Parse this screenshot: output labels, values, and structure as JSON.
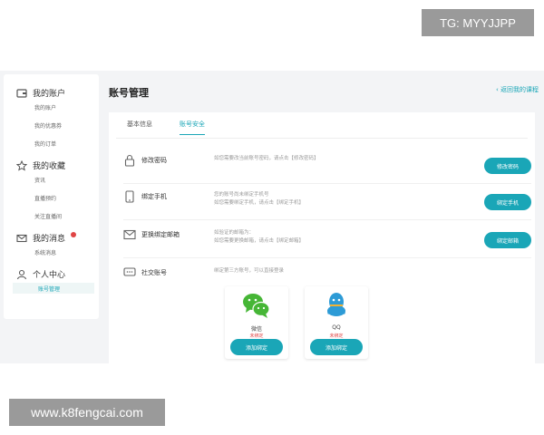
{
  "overlay": {
    "tg_label": "TG: MYYJJPP",
    "site_watermark": "www.k8fengcai.com"
  },
  "sidebar": {
    "groups": [
      {
        "title": "我的账户",
        "icon": "wallet-icon",
        "items": [
          "我的账户",
          "我的优惠券",
          "我的订单"
        ]
      },
      {
        "title": "我的收藏",
        "icon": "star-icon",
        "items": [
          "资讯",
          "直播预约",
          "关注直播间"
        ]
      },
      {
        "title": "我的消息",
        "icon": "mail-icon",
        "items": [
          "系统消息"
        ]
      },
      {
        "title": "个人中心",
        "icon": "user-icon",
        "items": [
          "账号管理"
        ]
      }
    ]
  },
  "main": {
    "title": "账号管理",
    "back_link": "返回我的课程",
    "tabs": [
      {
        "label": "基本信息",
        "active": false
      },
      {
        "label": "账号安全",
        "active": true
      }
    ],
    "rows": [
      {
        "icon": "lock-icon",
        "label": "修改密码",
        "desc1": "如您需要改当前账号密码，请点击【修改密码】",
        "desc2": "",
        "button": "修改密码"
      },
      {
        "icon": "phone-icon",
        "label": "绑定手机",
        "desc1": "您的账号尚未绑定手机号",
        "desc2": "如您需要绑定手机，请点击【绑定手机】",
        "button": "绑定手机"
      },
      {
        "icon": "mail-icon",
        "label": "更换绑定邮箱",
        "desc1": "如验证的邮箱为：",
        "desc2": "如您需要更换邮箱，请点击【绑定邮箱】",
        "button": "绑定邮箱"
      },
      {
        "icon": "chat-icon",
        "label": "社交账号",
        "desc1": "绑定第三方账号，可以直接登录",
        "desc2": "",
        "button": ""
      }
    ],
    "social": [
      {
        "name": "微信",
        "status": "未绑定",
        "button": "添加绑定",
        "icon": "wechat-icon"
      },
      {
        "name": "QQ",
        "status": "未绑定",
        "button": "添加绑定",
        "icon": "qq-icon"
      }
    ]
  },
  "colors": {
    "accent": "#1aa6b7",
    "wechat": "#46b636",
    "qq": "#2d9bd6",
    "alert": "#e04545"
  }
}
